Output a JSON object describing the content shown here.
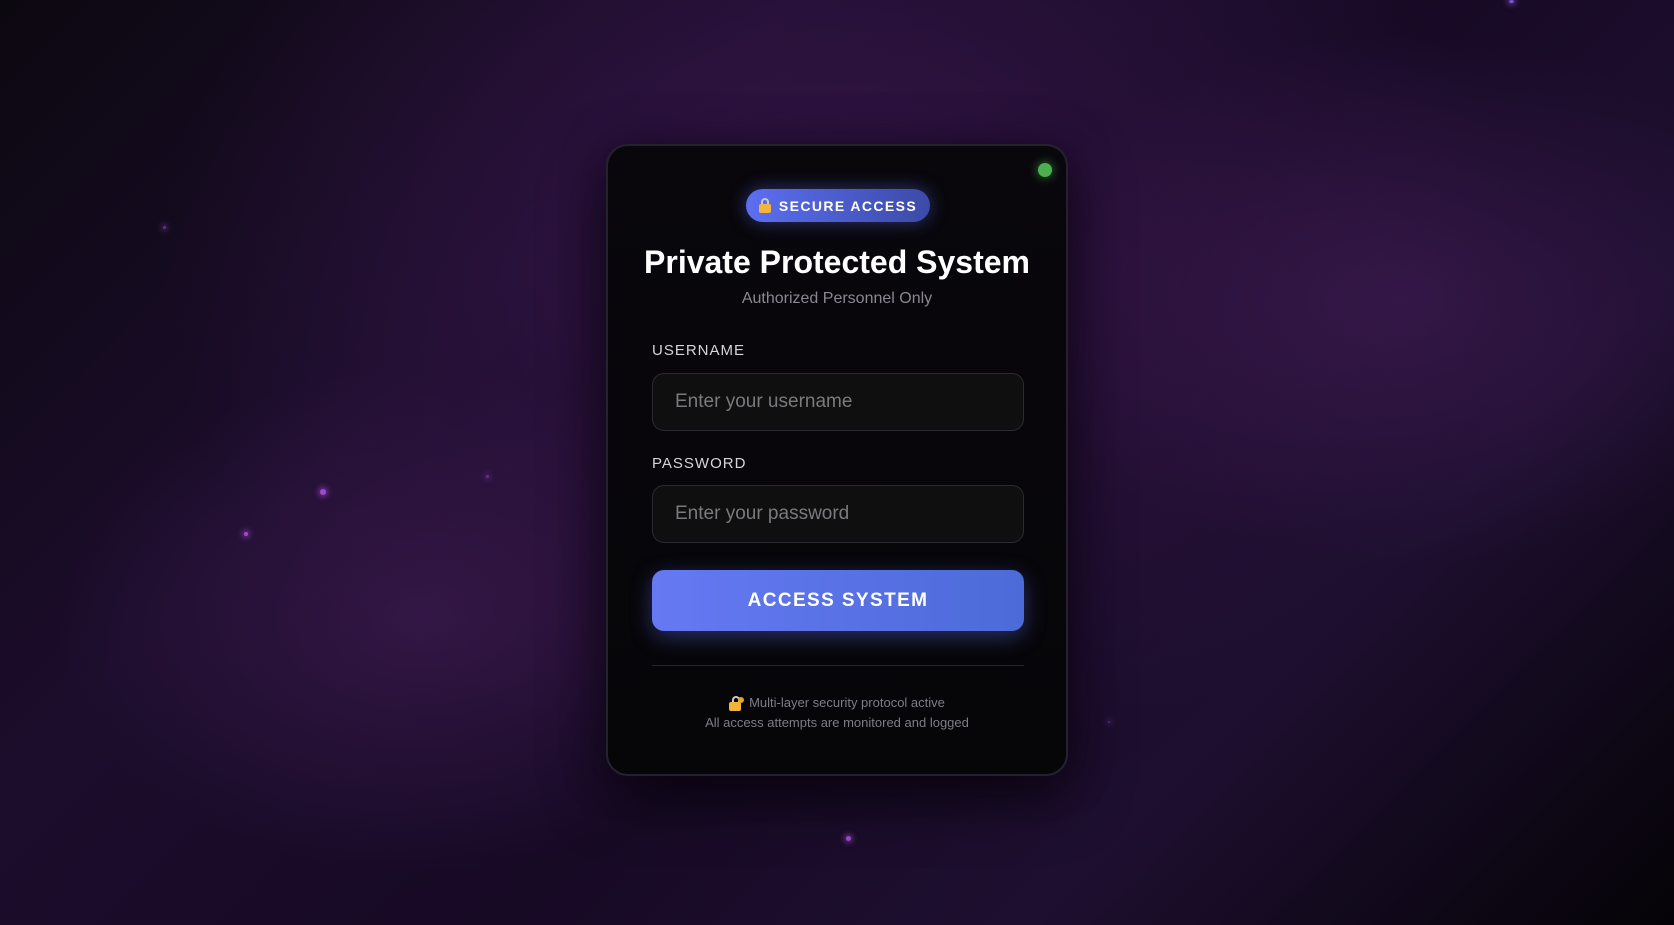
{
  "badge": {
    "icon": "lock-icon",
    "label": "SECURE ACCESS"
  },
  "header": {
    "title": "Private Protected System",
    "subtitle": "Authorized Personnel Only"
  },
  "form": {
    "username": {
      "label": "USERNAME",
      "placeholder": "Enter your username",
      "value": ""
    },
    "password": {
      "label": "PASSWORD",
      "placeholder": "Enter your password",
      "value": ""
    },
    "submit_label": "ACCESS SYSTEM"
  },
  "footer": {
    "icon": "lock-with-key-icon",
    "line1": "Multi-layer security protocol active",
    "line2": "All access attempts are monitored and logged"
  },
  "status": {
    "indicator_color": "#4caf50"
  },
  "colors": {
    "accent": "#5c6ff0",
    "button_gradient_start": "#6679f3",
    "button_gradient_end": "#4c6bd8",
    "card_background": "#09070c",
    "particle": "#a04ad0"
  }
}
